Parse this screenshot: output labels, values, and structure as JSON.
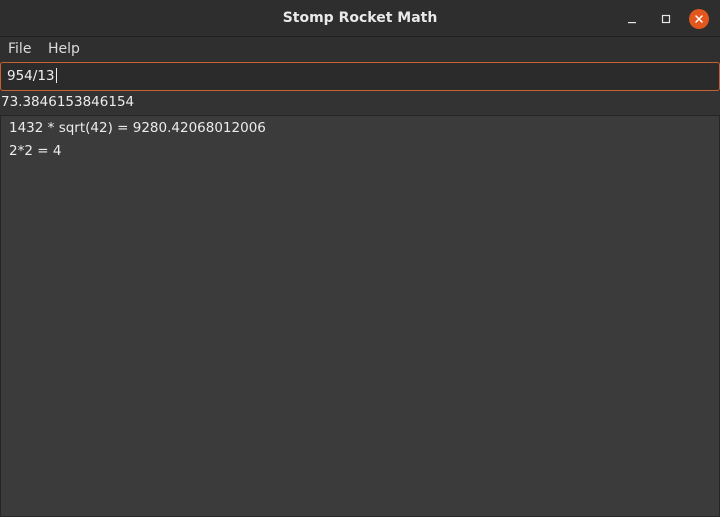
{
  "window": {
    "title": "Stomp Rocket Math",
    "controls": {
      "minimize_icon": "minimize-icon",
      "maximize_icon": "maximize-icon",
      "close_icon": "close-icon",
      "close_color": "#e2571e"
    }
  },
  "menu": {
    "items": [
      {
        "label": "File"
      },
      {
        "label": "Help"
      }
    ]
  },
  "input": {
    "value": "954/13",
    "focus_color": "#c66131"
  },
  "result": {
    "value": "73.3846153846154"
  },
  "history": [
    {
      "text": "1432 * sqrt(42) = 9280.42068012006"
    },
    {
      "text": "2*2 = 4"
    }
  ]
}
